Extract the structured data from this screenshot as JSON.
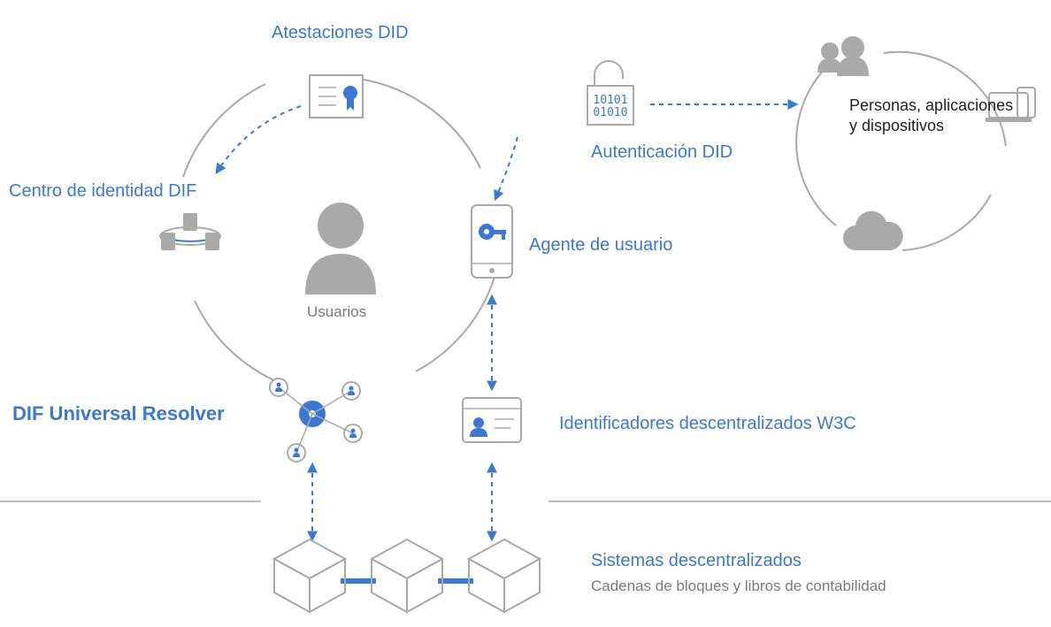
{
  "labels": {
    "attestations": "Atestaciones DID",
    "identityHub": "Centro de identidad DIF",
    "users": "Usuarios",
    "universalResolver": "DIF Universal Resolver",
    "userAgent": "Agente de usuario",
    "didAuth": "Autenticación DID",
    "w3cDIDs": "Identificadores descentralizados W3C",
    "decentralizedSystems": "Sistemas descentralizados",
    "decentralizedSystemsSub": "Cadenas de bloques y libros de contabilidad",
    "peopleAppsDevices1": "Personas, aplicaciones",
    "peopleAppsDevices2": "y dispositivos",
    "padlockBits1": "10101",
    "padlockBits2": "01010"
  },
  "colors": {
    "blue": "#3a78d4",
    "gray": "#a9a9a9",
    "textGray": "#7a7a7a"
  }
}
